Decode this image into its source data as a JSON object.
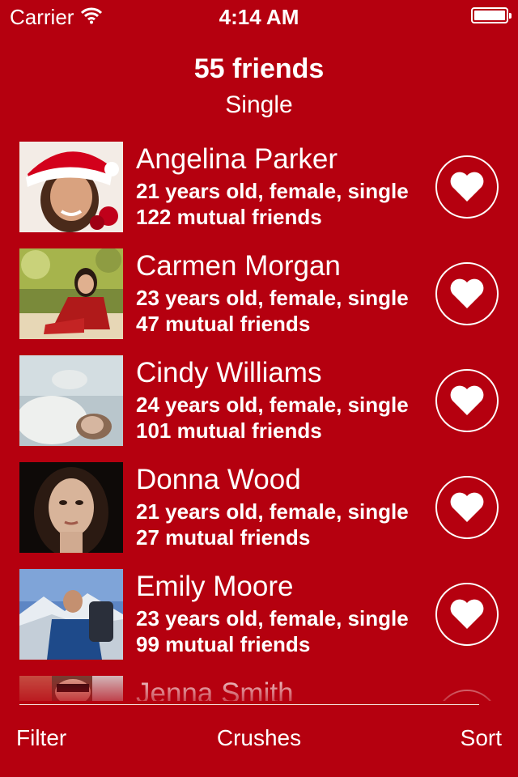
{
  "status_bar": {
    "carrier": "Carrier",
    "time": "4:14 AM"
  },
  "header": {
    "title": "55 friends",
    "subtitle": "Single"
  },
  "friends": [
    {
      "name": "Angelina Parker",
      "details": "21 years old, female, single",
      "mutual": "122 mutual friends"
    },
    {
      "name": "Carmen Morgan",
      "details": "23 years old, female, single",
      "mutual": "47 mutual friends"
    },
    {
      "name": "Cindy Williams",
      "details": "24 years old, female, single",
      "mutual": "101 mutual friends"
    },
    {
      "name": "Donna Wood",
      "details": "21 years old, female, single",
      "mutual": "27 mutual friends"
    },
    {
      "name": "Emily Moore",
      "details": "23 years old, female, single",
      "mutual": "99 mutual friends"
    },
    {
      "name": "Jenna Smith",
      "details": "",
      "mutual": ""
    }
  ],
  "tabbar": {
    "filter": "Filter",
    "crushes": "Crushes",
    "sort": "Sort"
  },
  "colors": {
    "background": "#b5000f",
    "foreground": "#ffffff"
  },
  "icons": {
    "wifi": "wifi-icon",
    "battery": "battery-icon",
    "heart": "heart-icon"
  }
}
